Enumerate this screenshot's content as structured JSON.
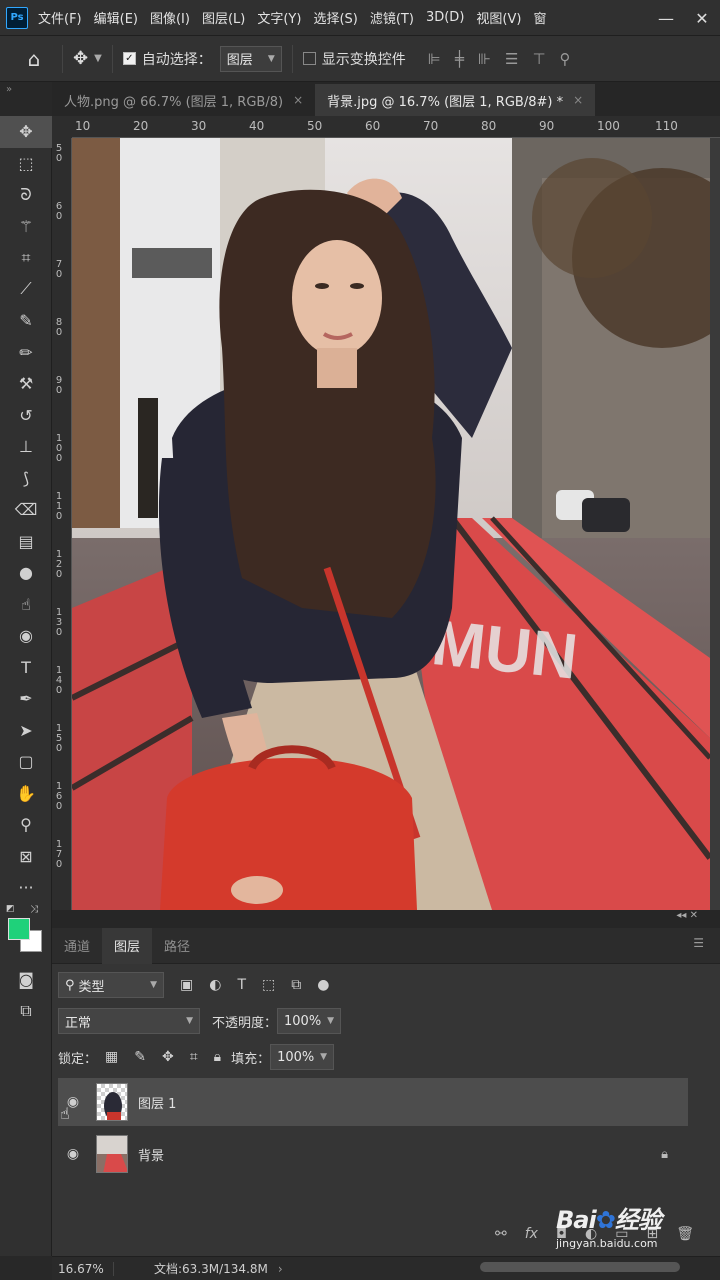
{
  "menu": [
    "文件(F)",
    "编辑(E)",
    "图像(I)",
    "图层(L)",
    "文字(Y)",
    "选择(S)",
    "滤镜(T)",
    "3D(D)",
    "视图(V)",
    "窗"
  ],
  "app_logo": "Ps",
  "window_controls": {
    "minimize": "—",
    "close": "✕"
  },
  "options": {
    "auto_select_label": "自动选择：",
    "auto_select_value": "图层",
    "show_transform_label": "显示变换控件"
  },
  "tabs": [
    {
      "label": "人物.png @ 66.7% (图层 1, RGB/8)",
      "close": "×",
      "active": false
    },
    {
      "label": "背景.jpg @ 16.7% (图层 1, RGB/8#) *",
      "close": "×",
      "active": true
    }
  ],
  "ruler_h": [
    "10",
    "20",
    "30",
    "40",
    "50",
    "60",
    "70",
    "80",
    "90",
    "100",
    "110"
  ],
  "ruler_v": [
    "50",
    "60",
    "70",
    "80",
    "90",
    "100",
    "110",
    "120",
    "130",
    "140",
    "150",
    "160",
    "170"
  ],
  "canvas_sign_text": "MUN",
  "panel": {
    "tabs": [
      "通道",
      "图层",
      "路径"
    ],
    "active_tab": "图层",
    "filter_label": "类型",
    "blend_mode": "正常",
    "opacity_label": "不透明度：",
    "opacity_value": "100%",
    "lock_label": "锁定：",
    "fill_label": "填充：",
    "fill_value": "100%",
    "layers": [
      {
        "name": "图层 1",
        "selected": true
      },
      {
        "name": "背景",
        "selected": false,
        "locked": true
      }
    ],
    "footer_fx": "fx"
  },
  "status": {
    "zoom": "16.67%",
    "doc": "文档:63.3M/134.8M"
  },
  "watermark": {
    "brand": "Bai",
    "brand2": "经验",
    "sub": "jingyan.baidu.com"
  },
  "colors": {
    "foreground": "#1fd17a",
    "background": "#ffffff"
  }
}
